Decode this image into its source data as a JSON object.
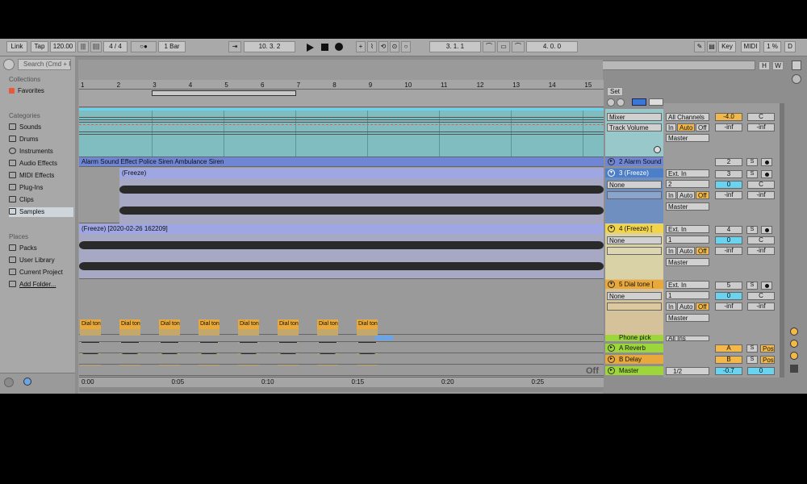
{
  "toolbar": {
    "link": "Link",
    "tap": "Tap",
    "tempo": "120.00",
    "signature": "4 / 4",
    "quantize": "1 Bar",
    "position": "10.  3.  2",
    "loop_start": "3.  1.  1",
    "loop_length": "4.  0.  0",
    "key": "Key",
    "midi": "MIDI",
    "cpu": "1 %",
    "d": "D"
  },
  "browser": {
    "search_placeholder": "Search (Cmd + F)",
    "collections_header": "Collections",
    "favorites": "Favorites",
    "categories_header": "Categories",
    "categories": [
      "Sounds",
      "Drums",
      "Instruments",
      "Audio Effects",
      "MIDI Effects",
      "Plug-Ins",
      "Clips",
      "Samples"
    ],
    "places_header": "Places",
    "places": [
      "Packs",
      "User Library",
      "Current Project",
      "Add Folder..."
    ]
  },
  "overview": {
    "h": "H",
    "w": "W"
  },
  "ruler": {
    "bars": [
      "1",
      "2",
      "3",
      "4",
      "5",
      "6",
      "7",
      "8",
      "9",
      "10",
      "11",
      "12",
      "13",
      "14",
      "15"
    ],
    "times": [
      "0:00",
      "0:05",
      "0:10",
      "0:15",
      "0:20",
      "0:25"
    ]
  },
  "tracks": {
    "t1": {
      "device": "Mixer",
      "param": "Track Volume",
      "input": "All Channels",
      "in": "In",
      "auto": "Auto",
      "off": "Off",
      "output": "Master",
      "volume": "-4.0",
      "pan": "C",
      "sendA": "-inf",
      "sendB": "-inf"
    },
    "t2": {
      "clip_text": "Alarm Sound Effect  Police Siren  Ambulance Siren",
      "name": "2 Alarm Sound Effect",
      "number": "2",
      "s": "S"
    },
    "t3": {
      "clip": "(Freeze)",
      "name": "3 (Freeze)",
      "none": "None",
      "input": "Ext. In",
      "channel": "2",
      "in": "In",
      "auto": "Auto",
      "off": "Off",
      "output": "Master",
      "number": "3",
      "s": "S",
      "vol": "0",
      "pan": "C",
      "sendA": "-inf",
      "sendB": "-inf"
    },
    "t4": {
      "clip": "(Freeze) [2020-02-26 162209]",
      "name": "4 (Freeze) [",
      "none": "None",
      "input": "Ext. In",
      "channel": "1",
      "in": "In",
      "auto": "Auto",
      "off": "Off",
      "output": "Master",
      "number": "4",
      "s": "S",
      "vol": "0",
      "pan": "C",
      "sendA": "-inf",
      "sendB": "-inf"
    },
    "t5": {
      "clip": "Dial tone",
      "name": "5 Dial tone [",
      "none": "None",
      "input": "Ext. In",
      "channel": "1",
      "in": "In",
      "auto": "Auto",
      "off": "Off",
      "output": "Master",
      "number": "5",
      "s": "S",
      "vol": "0",
      "pan": "C",
      "sendA": "-inf",
      "sendB": "-inf"
    },
    "t6": {
      "name": "Phone pick",
      "input": "All Ins"
    }
  },
  "returns": {
    "a": {
      "name": "A Reverb",
      "letter": "A",
      "s": "S",
      "post": "Post"
    },
    "b": {
      "name": "B Delay",
      "letter": "B",
      "s": "S",
      "post": "Post"
    }
  },
  "master": {
    "name": "Master",
    "ratio": "1/2",
    "volume": "-0.7",
    "pan": "0"
  },
  "set": "Set",
  "off_label": "Off",
  "colors": {
    "teal": "#7fbdc0",
    "blue": "#6f86d6",
    "lilac": "#9fa6e4",
    "orange": "#e8a83a",
    "green": "#9cd63a",
    "yellow": "#f2d44a"
  }
}
